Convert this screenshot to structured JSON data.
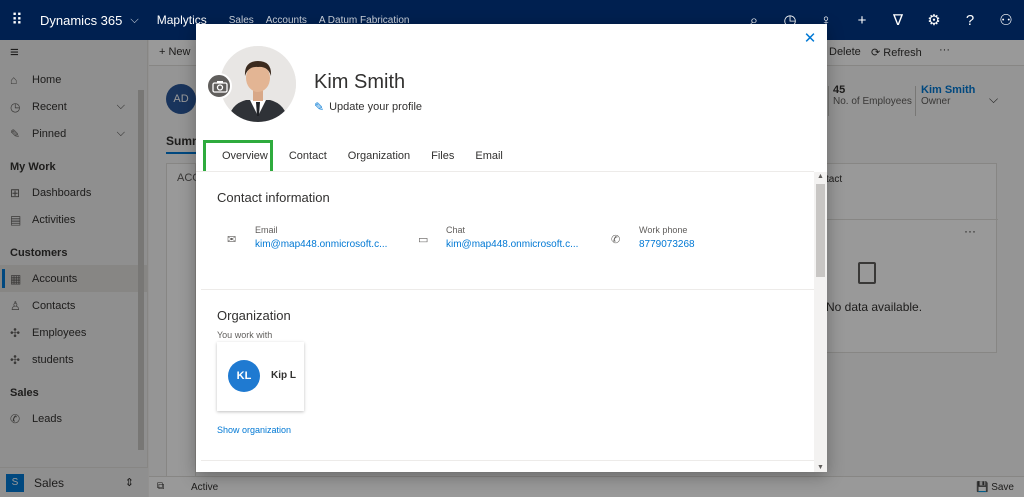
{
  "topbar": {
    "brand": "Dynamics 365",
    "app": "Maplytics",
    "breadcrumbs": [
      "Sales",
      "Accounts",
      "A Datum Fabrication"
    ]
  },
  "leftnav": {
    "home": "Home",
    "recent": "Recent",
    "pinned": "Pinned",
    "group_mywork": "My Work",
    "dashboards": "Dashboards",
    "activities": "Activities",
    "group_customers": "Customers",
    "accounts": "Accounts",
    "contacts": "Contacts",
    "employees": "Employees",
    "students": "students",
    "group_sales": "Sales",
    "leads": "Leads",
    "area_badge": "S",
    "area": "Sales"
  },
  "background": {
    "new_label": "New",
    "delete_label": "Delete",
    "refresh_label": "Refresh",
    "more": "···",
    "avatar": "AD",
    "employees_count": "45",
    "employees_label": "No. of Employees",
    "owner_name": "Kim Smith",
    "owner_label": "Owner",
    "summary_tab": "Summ",
    "acc_label": "ACC",
    "card_title": "tact",
    "no_data": "No data available.",
    "status": "Active",
    "save": "Save"
  },
  "dialog": {
    "name": "Kim Smith",
    "update_profile": "Update your profile",
    "tabs": [
      "Overview",
      "Contact",
      "Organization",
      "Files",
      "Email"
    ],
    "contact_title": "Contact information",
    "email_label": "Email",
    "email_value": "kim@map448.onmicrosoft.c...",
    "chat_label": "Chat",
    "chat_value": "kim@map448.onmicrosoft.c...",
    "phone_label": "Work phone",
    "phone_value": "8779073268",
    "org_title": "Organization",
    "you_work_with": "You work with",
    "org_initials": "KL",
    "org_name": "Kip L",
    "show_org": "Show organization"
  },
  "colors": {
    "topbar": "#002050",
    "accent": "#0078d4",
    "highlight": "#2eab3d",
    "org_avatar": "#1f7ad1"
  }
}
